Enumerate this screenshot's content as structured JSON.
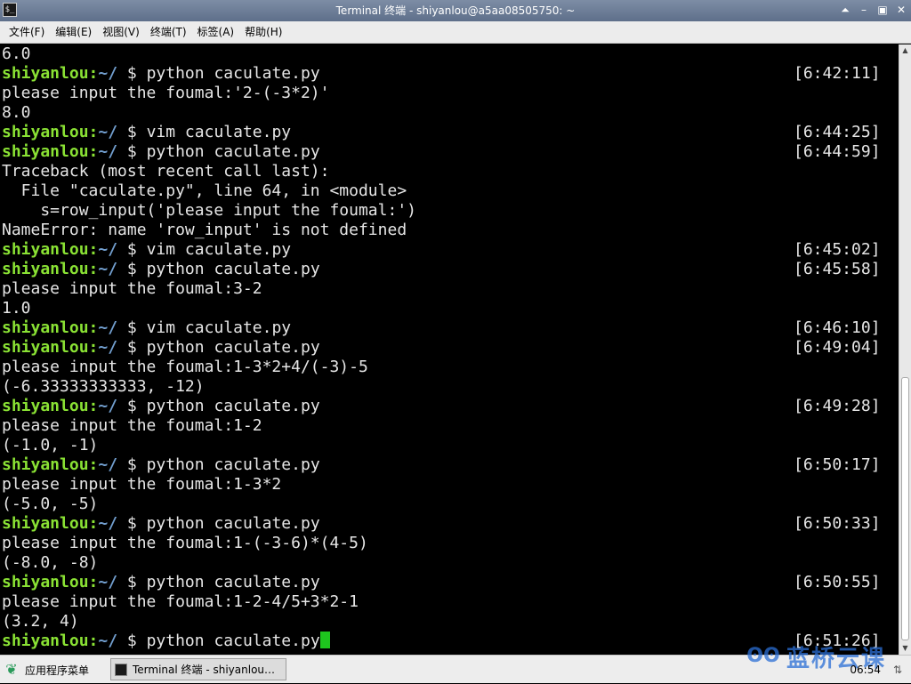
{
  "window": {
    "title": "Terminal 终端 - shiyanlou@a5aa08505750: ~",
    "app_icon": "terminal-icon",
    "app_icon_glyph": "$_",
    "controls": [
      {
        "name": "shade-button",
        "glyph": "⏶"
      },
      {
        "name": "minimize-button",
        "glyph": "–"
      },
      {
        "name": "maximize-button",
        "glyph": "▣"
      },
      {
        "name": "close-button",
        "glyph": "✕"
      }
    ]
  },
  "menu": {
    "items": [
      "文件(F)",
      "编辑(E)",
      "视图(V)",
      "终端(T)",
      "标签(A)",
      "帮助(H)"
    ]
  },
  "terminal": {
    "lines": [
      {
        "type": "out",
        "text": "6.0"
      },
      {
        "type": "prompt",
        "user": "shiyanlou",
        "sep": ":",
        "path": "~/",
        "cmd": " $ python caculate.py",
        "time": "[6:42:11]"
      },
      {
        "type": "out",
        "text": "please input the foumal:'2-(-3*2)'"
      },
      {
        "type": "out",
        "text": "8.0"
      },
      {
        "type": "prompt",
        "user": "shiyanlou",
        "sep": ":",
        "path": "~/",
        "cmd": " $ vim caculate.py",
        "time": "[6:44:25]"
      },
      {
        "type": "prompt",
        "user": "shiyanlou",
        "sep": ":",
        "path": "~/",
        "cmd": " $ python caculate.py",
        "time": "[6:44:59]"
      },
      {
        "type": "out",
        "text": "Traceback (most recent call last):"
      },
      {
        "type": "out",
        "text": "  File \"caculate.py\", line 64, in <module>"
      },
      {
        "type": "out",
        "text": "    s=row_input('please input the foumal:')"
      },
      {
        "type": "out",
        "text": "NameError: name 'row_input' is not defined"
      },
      {
        "type": "prompt",
        "user": "shiyanlou",
        "sep": ":",
        "path": "~/",
        "cmd": " $ vim caculate.py",
        "time": "[6:45:02]"
      },
      {
        "type": "prompt",
        "user": "shiyanlou",
        "sep": ":",
        "path": "~/",
        "cmd": " $ python caculate.py",
        "time": "[6:45:58]"
      },
      {
        "type": "out",
        "text": "please input the foumal:3-2"
      },
      {
        "type": "out",
        "text": "1.0"
      },
      {
        "type": "prompt",
        "user": "shiyanlou",
        "sep": ":",
        "path": "~/",
        "cmd": " $ vim caculate.py",
        "time": "[6:46:10]"
      },
      {
        "type": "prompt",
        "user": "shiyanlou",
        "sep": ":",
        "path": "~/",
        "cmd": " $ python caculate.py",
        "time": "[6:49:04]"
      },
      {
        "type": "out",
        "text": "please input the foumal:1-3*2+4/(-3)-5"
      },
      {
        "type": "out",
        "text": "(-6.33333333333, -12)"
      },
      {
        "type": "prompt",
        "user": "shiyanlou",
        "sep": ":",
        "path": "~/",
        "cmd": " $ python caculate.py",
        "time": "[6:49:28]"
      },
      {
        "type": "out",
        "text": "please input the foumal:1-2"
      },
      {
        "type": "out",
        "text": "(-1.0, -1)"
      },
      {
        "type": "prompt",
        "user": "shiyanlou",
        "sep": ":",
        "path": "~/",
        "cmd": " $ python caculate.py",
        "time": "[6:50:17]"
      },
      {
        "type": "out",
        "text": "please input the foumal:1-3*2"
      },
      {
        "type": "out",
        "text": "(-5.0, -5)"
      },
      {
        "type": "prompt",
        "user": "shiyanlou",
        "sep": ":",
        "path": "~/",
        "cmd": " $ python caculate.py",
        "time": "[6:50:33]"
      },
      {
        "type": "out",
        "text": "please input the foumal:1-(-3-6)*(4-5)"
      },
      {
        "type": "out",
        "text": "(-8.0, -8)"
      },
      {
        "type": "prompt",
        "user": "shiyanlou",
        "sep": ":",
        "path": "~/",
        "cmd": " $ python caculate.py",
        "time": "[6:50:55]"
      },
      {
        "type": "out",
        "text": "please input the foumal:1-2-4/5+3*2-1"
      },
      {
        "type": "out",
        "text": "(3.2, 4)"
      },
      {
        "type": "prompt",
        "user": "shiyanlou",
        "sep": ":",
        "path": "~/",
        "cmd": " $ python caculate.py",
        "time": "[6:51:26]",
        "cursor": true
      }
    ],
    "colors": {
      "user": "#8ae234",
      "path": "#729fcf",
      "cursor": "#1ec51e",
      "text": "#e6e6e6"
    }
  },
  "scrollbar": {
    "position_fraction": 1.0
  },
  "taskbar": {
    "start_label": "应用程序菜单",
    "start_icon": "leaf-icon",
    "task_label": "Terminal 终端 - shiyanlou@…",
    "task_icon": "terminal-icon",
    "watermark_text": "蓝桥云课",
    "watermark_icon": "lanqiao-logo-icon",
    "clock": "06:54",
    "tray_icon": "network-icon"
  }
}
